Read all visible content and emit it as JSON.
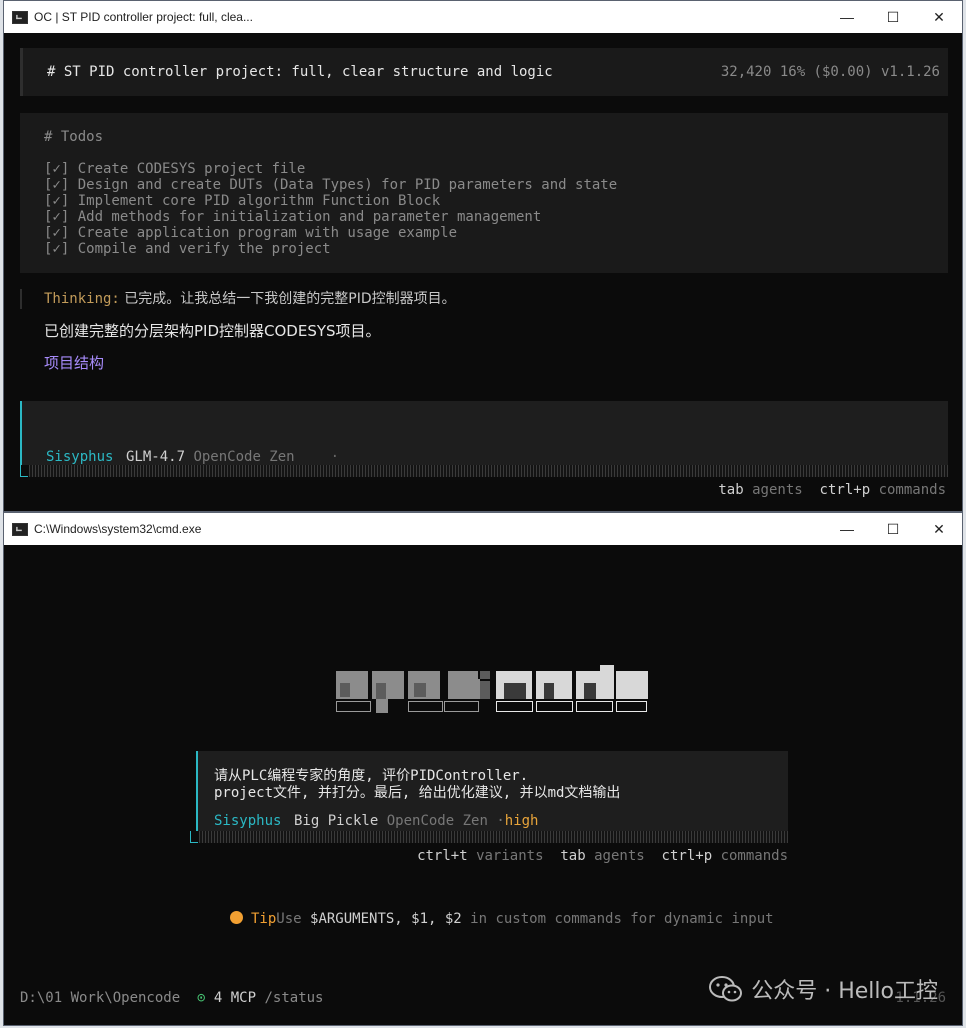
{
  "win1": {
    "title": "OC | ST PID controller project: full, clea...",
    "controls": {
      "min": "—",
      "max": "☐",
      "close": "✕"
    },
    "header": {
      "title": "# ST PID controller project: full, clear structure and logic",
      "meta": "32,420  16% ($0.00) v1.1.26"
    },
    "todos": {
      "heading": "# Todos",
      "items": [
        "[✓] Create CODESYS project file",
        "[✓] Design and create DUTs (Data Types) for PID parameters and state",
        "[✓] Implement core PID algorithm Function Block",
        "[✓] Add methods for initialization and parameter management",
        "[✓] Create application program with usage example",
        "[✓] Compile and verify the project"
      ]
    },
    "thinking": {
      "label": "Thinking:",
      "text": " 已完成。让我总结一下我创建的完整PID控制器项目。"
    },
    "summary": "已创建完整的分层架构PID控制器CODESYS项目。",
    "structure_link": "项目结构",
    "input": {
      "agent": "Sisyphus",
      "model": "GLM-4.7",
      "provider": "OpenCode Zen",
      "dot": "·"
    },
    "hints": {
      "tab": "tab",
      "tab_label": "agents",
      "ctrlp": "ctrl+p",
      "ctrlp_label": "commands"
    }
  },
  "win2": {
    "title": "C:\\Windows\\system32\\cmd.exe",
    "controls": {
      "min": "—",
      "max": "☐",
      "close": "✕"
    },
    "logo_text": "opencode",
    "prompt": {
      "line1": "请从PLC编程专家的角度, 评价PIDController.",
      "line2": "project文件, 并打分。最后, 给出优化建议, 并以md文档输出",
      "agent": "Sisyphus",
      "model": "Big Pickle",
      "provider": "OpenCode Zen",
      "effort_dot": "·",
      "effort": "high"
    },
    "hints": {
      "ctrlt": "ctrl+t",
      "ctrlt_label": "variants",
      "tab": "tab",
      "tab_label": "agents",
      "ctrlp": "ctrl+p",
      "ctrlp_label": "commands"
    },
    "tip": {
      "label": "Tip",
      "pre": "Use ",
      "args": "$ARGUMENTS, $1, $2",
      "post": " in custom commands for dynamic input"
    },
    "status": {
      "path": "D:\\01 Work\\Opencode",
      "mcp_icon": "⊙",
      "mcp": "4 MCP",
      "cmd": "/status"
    },
    "version": "1.1.26",
    "watermark": "公众号 · Hello工控"
  }
}
